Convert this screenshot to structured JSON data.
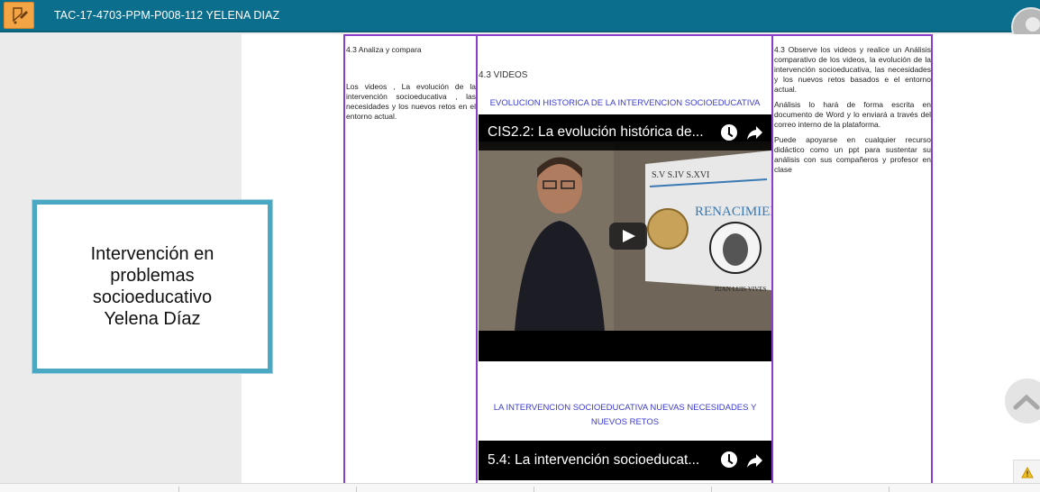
{
  "topbar": {
    "title": "TAC-17-4703-PPM-P008-112 YELENA DIAZ",
    "color": "#0b6e8c",
    "icon": "document-pen-icon"
  },
  "info_box": {
    "line1": "Intervención en",
    "line2": "problemas",
    "line3": "socioeducativo",
    "line4": "Yelena Díaz",
    "border_color": "#4ba8c3"
  },
  "col1": {
    "title": "4.3 Analiza y compara",
    "body": "Los videos , La evolución de la intervención socioeducativa , las necesidades y los nuevos retos en el entorno actual."
  },
  "col2": {
    "header": "4.3 VIDEOS",
    "link1": "EVOLUCION HISTORICA DE LA INTERVENCION SOCIOEDUCATIVA",
    "video1": {
      "title": "CIS2.2: La evolución histórica de...",
      "slide_dates": "S.V  S.IV  S.XVI",
      "slide_heading": "RENACIMIENTO",
      "slide_caption": "JUAN LUIS VIVES"
    },
    "link2_line1": "LA INTERVENCION SOCIOEDUCATIVA NUEVAS NECESIDADES Y",
    "link2_line2": "NUEVOS RETOS",
    "video2": {
      "title": "5.4: La intervención socioeducat..."
    }
  },
  "col3": {
    "p1": "4.3  Observe los videos y realice un Análisis comparativo de los videos, la evolución de la intervención socioeducativa, las necesidades y los nuevos retos basados e el entorno actual.",
    "p2": "Análisis lo hará de forma escrita en documento de Word  y lo enviará a través del correo interno de la plataforma.",
    "p3": "Puede apoyarse en cualquier recurso didáctico como un ppt para sustentar su análisis con sus compañeros y profesor en clase"
  },
  "accent_purple": "#8a3ec9"
}
